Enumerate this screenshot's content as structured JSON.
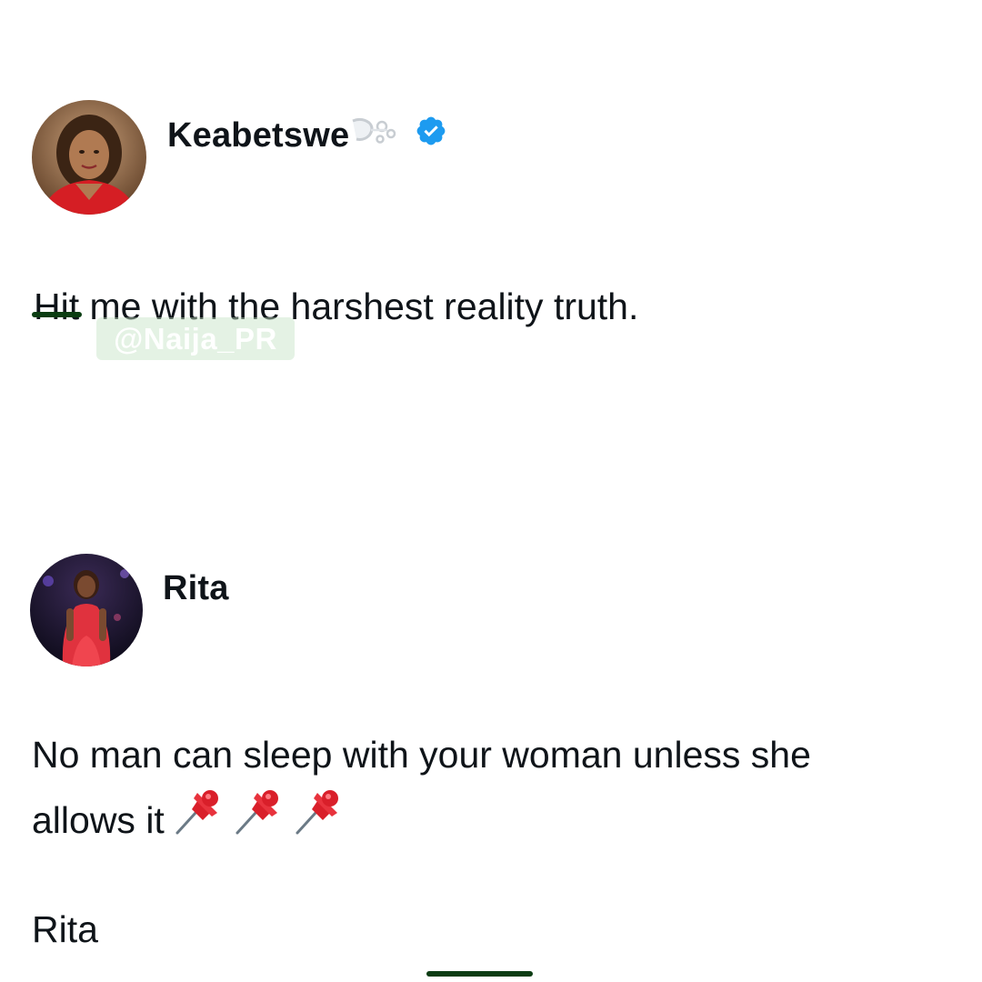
{
  "post": {
    "author": {
      "display_name": "Keabetswe",
      "name_emoji": "dash-emoji",
      "verified": true,
      "avatar": "avatar-keabetswe"
    },
    "text_struck": "Hit",
    "text_rest": " me with the harshest reality truth."
  },
  "watermark": "@Naija_PR",
  "reply": {
    "author": {
      "display_name": "Rita",
      "avatar": "avatar-rita"
    },
    "line1": "No man can sleep with your woman unless she",
    "line2": "allows it",
    "line2_emojis": [
      "pushpin-emoji",
      "pushpin-emoji",
      "pushpin-emoji"
    ],
    "signature": "Rita"
  },
  "colors": {
    "verified_blue": "#1d9bf0",
    "text": "#0f1419",
    "strike": "#0b3d12",
    "home_indicator": "#0d3d14"
  }
}
